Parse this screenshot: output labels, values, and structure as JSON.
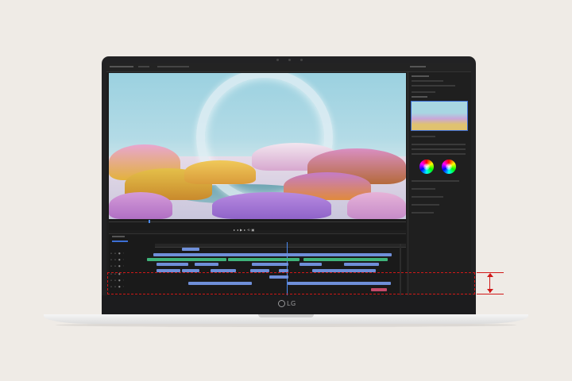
{
  "brand": {
    "logo_text": "LG"
  },
  "colors": {
    "annotation": "#d01818",
    "video_clip": "#6f8fd9",
    "audio_clip": "#3fb37a",
    "playhead": "#4a8af0"
  },
  "icons": {
    "camera": "webcam-icon"
  }
}
